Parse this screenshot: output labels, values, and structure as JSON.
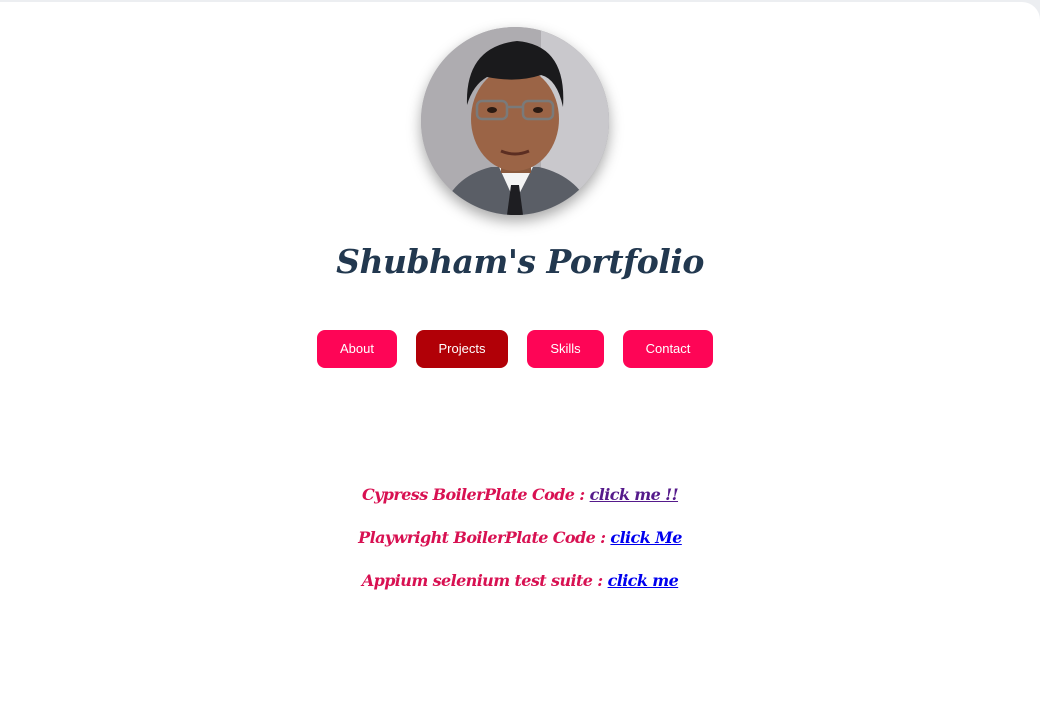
{
  "profile": {
    "title": "Shubham's Portfolio",
    "avatar_alt": "profile-photo"
  },
  "nav": {
    "items": [
      {
        "label": "About",
        "active": false
      },
      {
        "label": "Projects",
        "active": true
      },
      {
        "label": "Skills",
        "active": false
      },
      {
        "label": "Contact",
        "active": false
      }
    ]
  },
  "projects": [
    {
      "label": "Cypress BoilerPlate Code : ",
      "link": "click me !!",
      "visited": true
    },
    {
      "label": "Playwright BoilerPlate Code : ",
      "link": "click Me",
      "visited": false
    },
    {
      "label": "Appium selenium test suite : ",
      "link": "click me",
      "visited": false
    }
  ],
  "colors": {
    "button": "#fe0556",
    "button_active": "#b10007",
    "title": "#22384f",
    "project_text": "#d81152",
    "link": "#0000ee",
    "link_visited": "#551a8b"
  }
}
